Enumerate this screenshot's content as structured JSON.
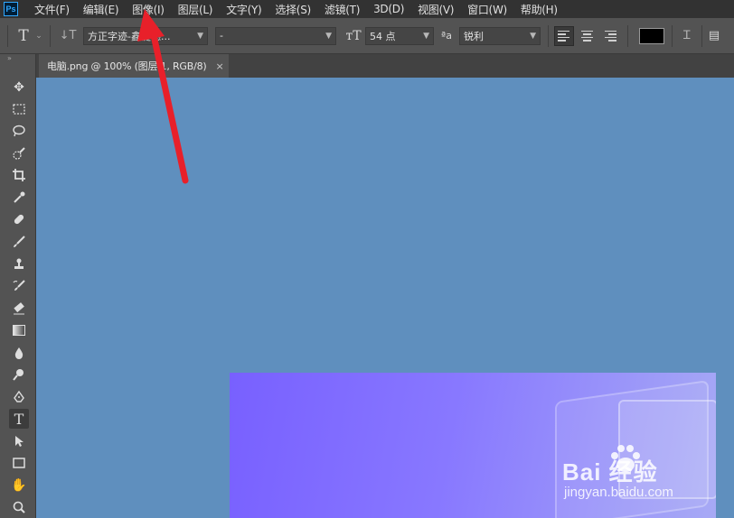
{
  "app": {
    "logo_text": "Ps"
  },
  "menu": {
    "items": [
      "文件(F)",
      "编辑(E)",
      "图像(I)",
      "图层(L)",
      "文字(Y)",
      "选择(S)",
      "滤镜(T)",
      "3D(D)",
      "视图(V)",
      "窗口(W)",
      "帮助(H)"
    ]
  },
  "options": {
    "font_family": "方正字迹-鑫键德...",
    "font_style": "-",
    "font_size": "54 点",
    "antialias_label": "ªa",
    "antialias_value": "锐利"
  },
  "document": {
    "tab_title": "电脑.png @ 100% (图层 1, RGB/8)",
    "close_glyph": "×"
  },
  "colors": {
    "canvas_bg": "#5f8fbe",
    "text_color": "#000000",
    "arrow": "#e8202a"
  },
  "watermark": {
    "brand": "Bai  经验",
    "url": "jingyan.baidu.com"
  }
}
